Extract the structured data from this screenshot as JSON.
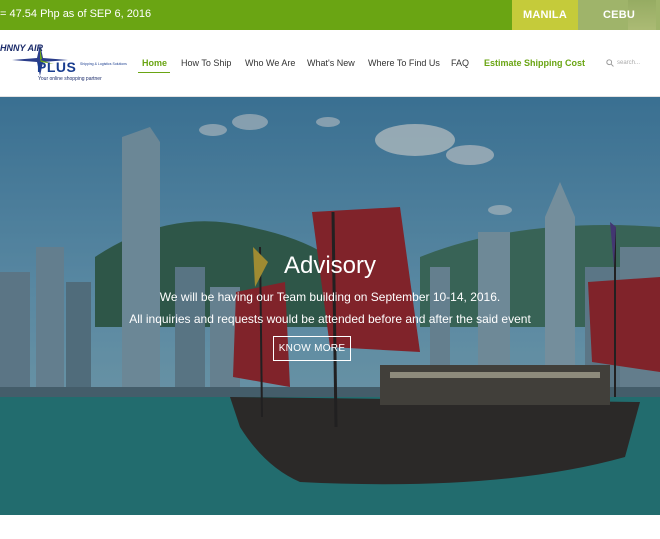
{
  "topbar": {
    "rate_text": "= 47.54 Php as of SEP 6, 2016",
    "branches": [
      "MANILA",
      "CEBU"
    ],
    "colors": {
      "bar": "#6aa513",
      "manila": "#c5cb3a",
      "cebu": "#9fb46a"
    }
  },
  "logo": {
    "brand_top": "HNNY AIR",
    "brand_plus": "PLUS",
    "small_text": "Shipping & Logistics Solutions",
    "tagline": "Your online shopping partner"
  },
  "nav": {
    "items": [
      "Home",
      "How To Ship",
      "Who We Are",
      "What's New",
      "Where To Find Us",
      "FAQ",
      "Estimate Shipping Cost"
    ],
    "active": "Home",
    "accent": "#6aa513"
  },
  "search": {
    "placeholder": "search...",
    "icon": "search-icon"
  },
  "hero": {
    "title": "Advisory",
    "line1": "We will be having our Team building on September 10-14, 2016.",
    "line2": "All inquiries and requests would be attended before and after the said event",
    "button": "KNOW MORE"
  }
}
